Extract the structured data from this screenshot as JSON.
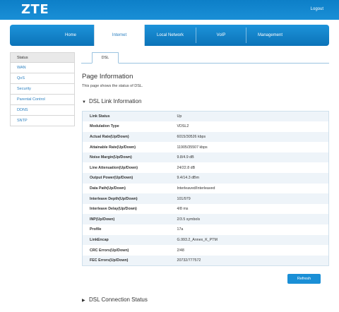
{
  "header": {
    "logo": "ZTE",
    "logout": "Logout"
  },
  "nav": {
    "tabs": [
      {
        "label": "Home"
      },
      {
        "label": "Internet"
      },
      {
        "label": "Local Network"
      },
      {
        "label": "VoIP"
      },
      {
        "label": "Management"
      }
    ],
    "active": "Internet"
  },
  "sidebar": {
    "items": [
      {
        "label": "Status"
      },
      {
        "label": "WAN"
      },
      {
        "label": "QoS"
      },
      {
        "label": "Security"
      },
      {
        "label": "Parental Control"
      },
      {
        "label": "DDNS"
      },
      {
        "label": "SNTP"
      }
    ],
    "active": "Status"
  },
  "subtabs": {
    "dsl": "DSL"
  },
  "page": {
    "title": "Page Information",
    "description": "This page shows the status of DSL."
  },
  "dsl_link": {
    "heading": "DSL Link Information",
    "rows": [
      {
        "label": "Link Status",
        "value": "Up"
      },
      {
        "label": "Modulation Type",
        "value": "VDSL2"
      },
      {
        "label": "Actual Rate(Up/Down)",
        "value": "6015/30526 kbps"
      },
      {
        "label": "Attainable Rate(Up/Down)",
        "value": "11905/35507 kbps"
      },
      {
        "label": "Noise Margin(Up/Down)",
        "value": "9.8/4.9 dB"
      },
      {
        "label": "Line Attenuation(Up/Down)",
        "value": "24/22.8 dB"
      },
      {
        "label": "Output Power(Up/Down)",
        "value": "9.4/14.3 dBm"
      },
      {
        "label": "Data Path(Up/Down)",
        "value": "Interleaved/Interleaved"
      },
      {
        "label": "Interleave Depth(Up/Down)",
        "value": "101/979"
      },
      {
        "label": "Interleave Delay(Up/Down)",
        "value": "4/8 ms"
      },
      {
        "label": "INP(Up/Down)",
        "value": "2/3.5 symbols"
      },
      {
        "label": "Profile",
        "value": "17a"
      },
      {
        "label": "LinkEncap",
        "value": "G.993.2_Annex_K_PTM"
      },
      {
        "label": "CRC Errors(Up/Down)",
        "value": "2/48"
      },
      {
        "label": "FEC Errors(Up/Down)",
        "value": "20732/777572"
      }
    ]
  },
  "buttons": {
    "refresh": "Refresh"
  },
  "dsl_connection": {
    "heading": "DSL Connection Status"
  },
  "colors": {
    "brand_blue": "#1a8fd6",
    "link_blue": "#2a7fc0",
    "row_tint": "#eef4f9"
  },
  "icons": {
    "expanded": "triangle-down-icon",
    "collapsed": "triangle-right-icon"
  }
}
